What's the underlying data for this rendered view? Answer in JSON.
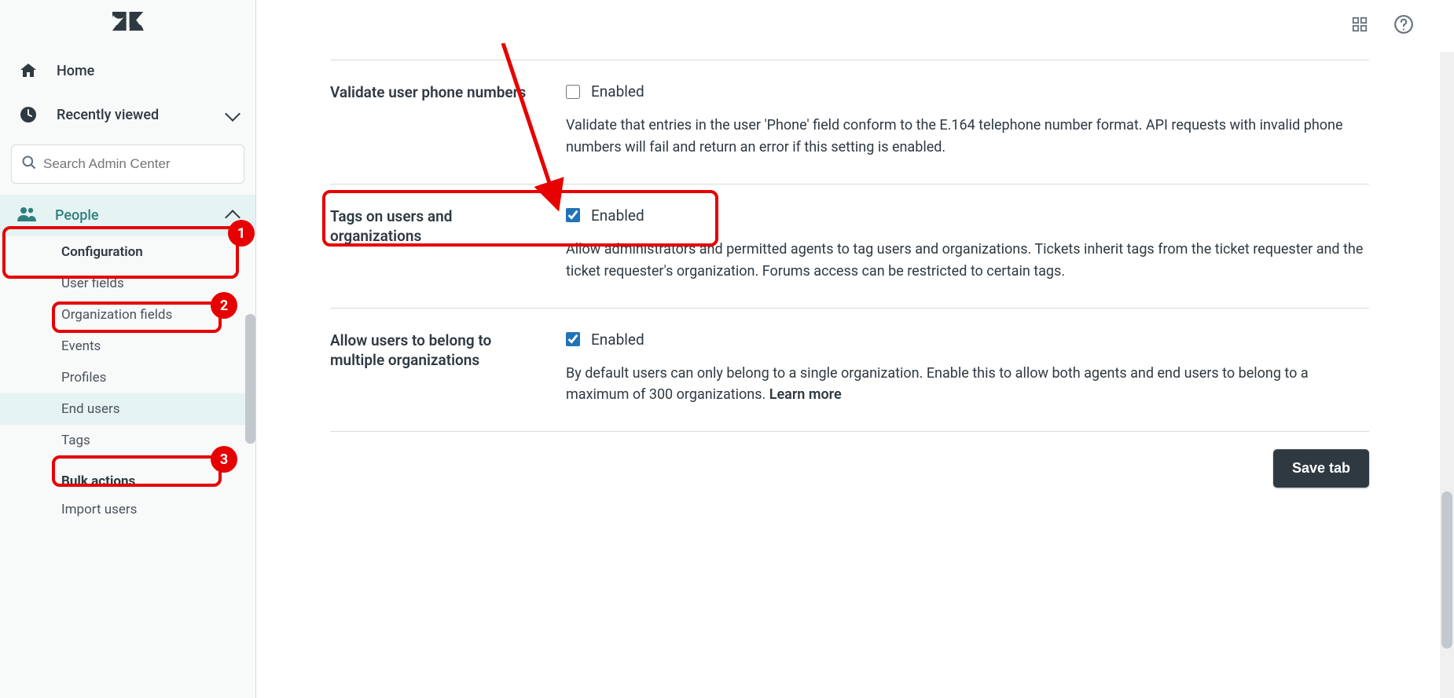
{
  "sidebar": {
    "home_label": "Home",
    "recently_viewed_label": "Recently viewed",
    "search_placeholder": "Search Admin Center",
    "group_people_label": "People",
    "subnav": {
      "configuration_header": "Configuration",
      "items": [
        {
          "label": "User fields"
        },
        {
          "label": "Organization fields"
        },
        {
          "label": "Events"
        },
        {
          "label": "Profiles"
        },
        {
          "label": "End users"
        },
        {
          "label": "Tags"
        }
      ],
      "bulk_header": "Bulk actions",
      "bulk_items": [
        {
          "label": "Import users"
        }
      ]
    }
  },
  "settings": [
    {
      "id": "validate_phone",
      "label": "Validate user phone numbers",
      "checkbox_label": "Enabled",
      "checked": false,
      "desc": "Validate that entries in the user 'Phone' field conform to the E.164 telephone number format. API requests with invalid phone numbers will fail and return an error if this setting is enabled."
    },
    {
      "id": "tags_users_orgs",
      "label": "Tags on users and organizations",
      "checkbox_label": "Enabled",
      "checked": true,
      "desc": "Allow administrators and permitted agents to tag users and organizations. Tickets inherit tags from the ticket requester and the ticket requester's organization. Forums access can be restricted to certain tags."
    },
    {
      "id": "multi_orgs",
      "label": "Allow users to belong to multiple organizations",
      "checkbox_label": "Enabled",
      "checked": true,
      "desc": "By default users can only belong to a single organization. Enable this to allow both agents and end users to belong to a maximum of 300 organizations. ",
      "learn_more": "Learn more"
    }
  ],
  "buttons": {
    "save_tab": "Save tab"
  },
  "annotations": {
    "badge1": "1",
    "badge2": "2",
    "badge3": "3"
  }
}
